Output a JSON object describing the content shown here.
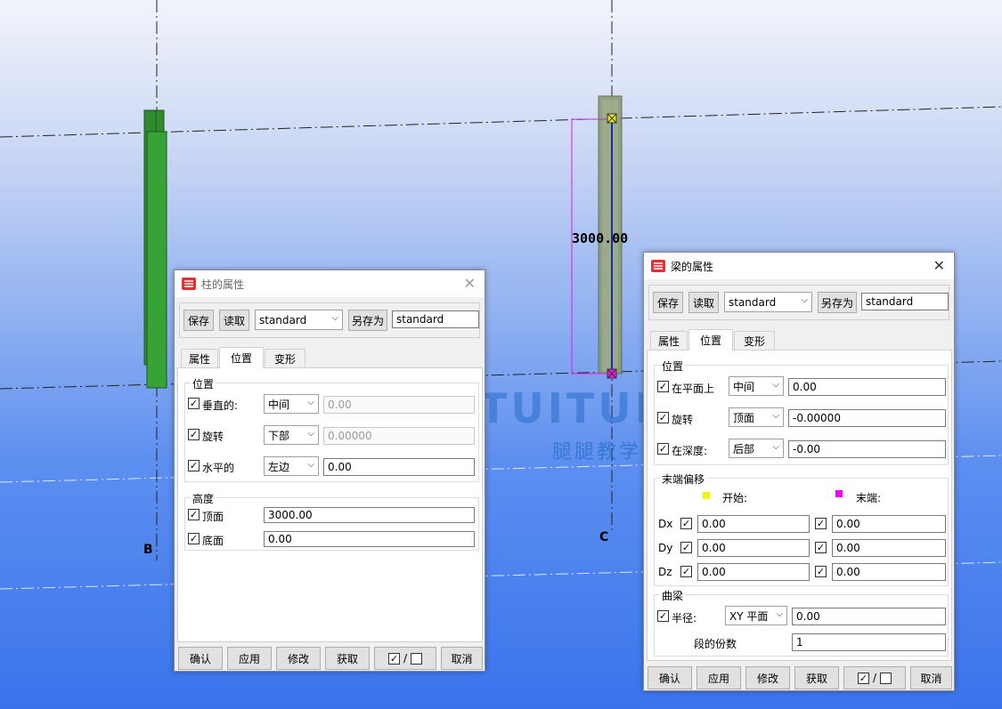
{
  "viewport": {
    "grid_labels": {
      "b": "B",
      "c": "C"
    },
    "dimension": "3000.00",
    "watermark": {
      "brand": "TUITUISOFT",
      "sub": "腿腿教学网"
    }
  },
  "column_dialog": {
    "title": "柱的属性",
    "close_glyph": "✕",
    "toolbar": {
      "save": "保存",
      "load": "读取",
      "preset": "standard",
      "save_as": "另存为",
      "save_as_name": "standard"
    },
    "tabs": [
      "属性",
      "位置",
      "变形"
    ],
    "active_tab": "位置",
    "position": {
      "title": "位置",
      "rows": [
        {
          "label": "垂直的:",
          "checked": true,
          "select": "中间",
          "value": "0.00",
          "disabled": true
        },
        {
          "label": "旋转",
          "checked": true,
          "select": "下部",
          "value": "0.00000",
          "disabled": true
        },
        {
          "label": "水平的",
          "checked": true,
          "select": "左边",
          "value": "0.00",
          "disabled": false
        }
      ]
    },
    "height": {
      "title": "高度",
      "rows": [
        {
          "label": "顶面",
          "checked": true,
          "value": "3000.00"
        },
        {
          "label": "底面",
          "checked": true,
          "value": "0.00"
        }
      ]
    },
    "footer": {
      "ok": "确认",
      "apply": "应用",
      "modify": "修改",
      "get": "获取",
      "toggle_on": "✓",
      "toggle_sep": "/",
      "cancel": "取消"
    }
  },
  "beam_dialog": {
    "title": "梁的属性",
    "close_glyph": "✕",
    "toolbar": {
      "save": "保存",
      "load": "读取",
      "preset": "standard",
      "save_as": "另存为",
      "save_as_name": "standard"
    },
    "tabs": [
      "属性",
      "位置",
      "变形"
    ],
    "active_tab": "位置",
    "position": {
      "title": "位置",
      "rows": [
        {
          "label": "在平面上",
          "checked": true,
          "select": "中间",
          "value": "0.00"
        },
        {
          "label": "旋转",
          "checked": true,
          "select": "顶面",
          "value": "-0.00000"
        },
        {
          "label": "在深度:",
          "checked": true,
          "select": "后部",
          "value": "-0.00"
        }
      ]
    },
    "end_offset": {
      "title": "末端偏移",
      "start_label": "开始:",
      "end_label": "末端:",
      "start_color": "#f5f500",
      "end_color": "#f000f0",
      "rows": [
        {
          "axis": "Dx",
          "start": "0.00",
          "end": "0.00"
        },
        {
          "axis": "Dy",
          "start": "0.00",
          "end": "0.00"
        },
        {
          "axis": "Dz",
          "start": "0.00",
          "end": "0.00"
        }
      ]
    },
    "curved": {
      "title": "曲梁",
      "radius_label": "半径:",
      "plane": "XY 平面",
      "radius": "0.00",
      "segments_label": "段的份数",
      "segments": "1"
    },
    "footer": {
      "ok": "确认",
      "apply": "应用",
      "modify": "修改",
      "get": "获取",
      "toggle_on": "✓",
      "toggle_sep": "/",
      "cancel": "取消"
    }
  }
}
